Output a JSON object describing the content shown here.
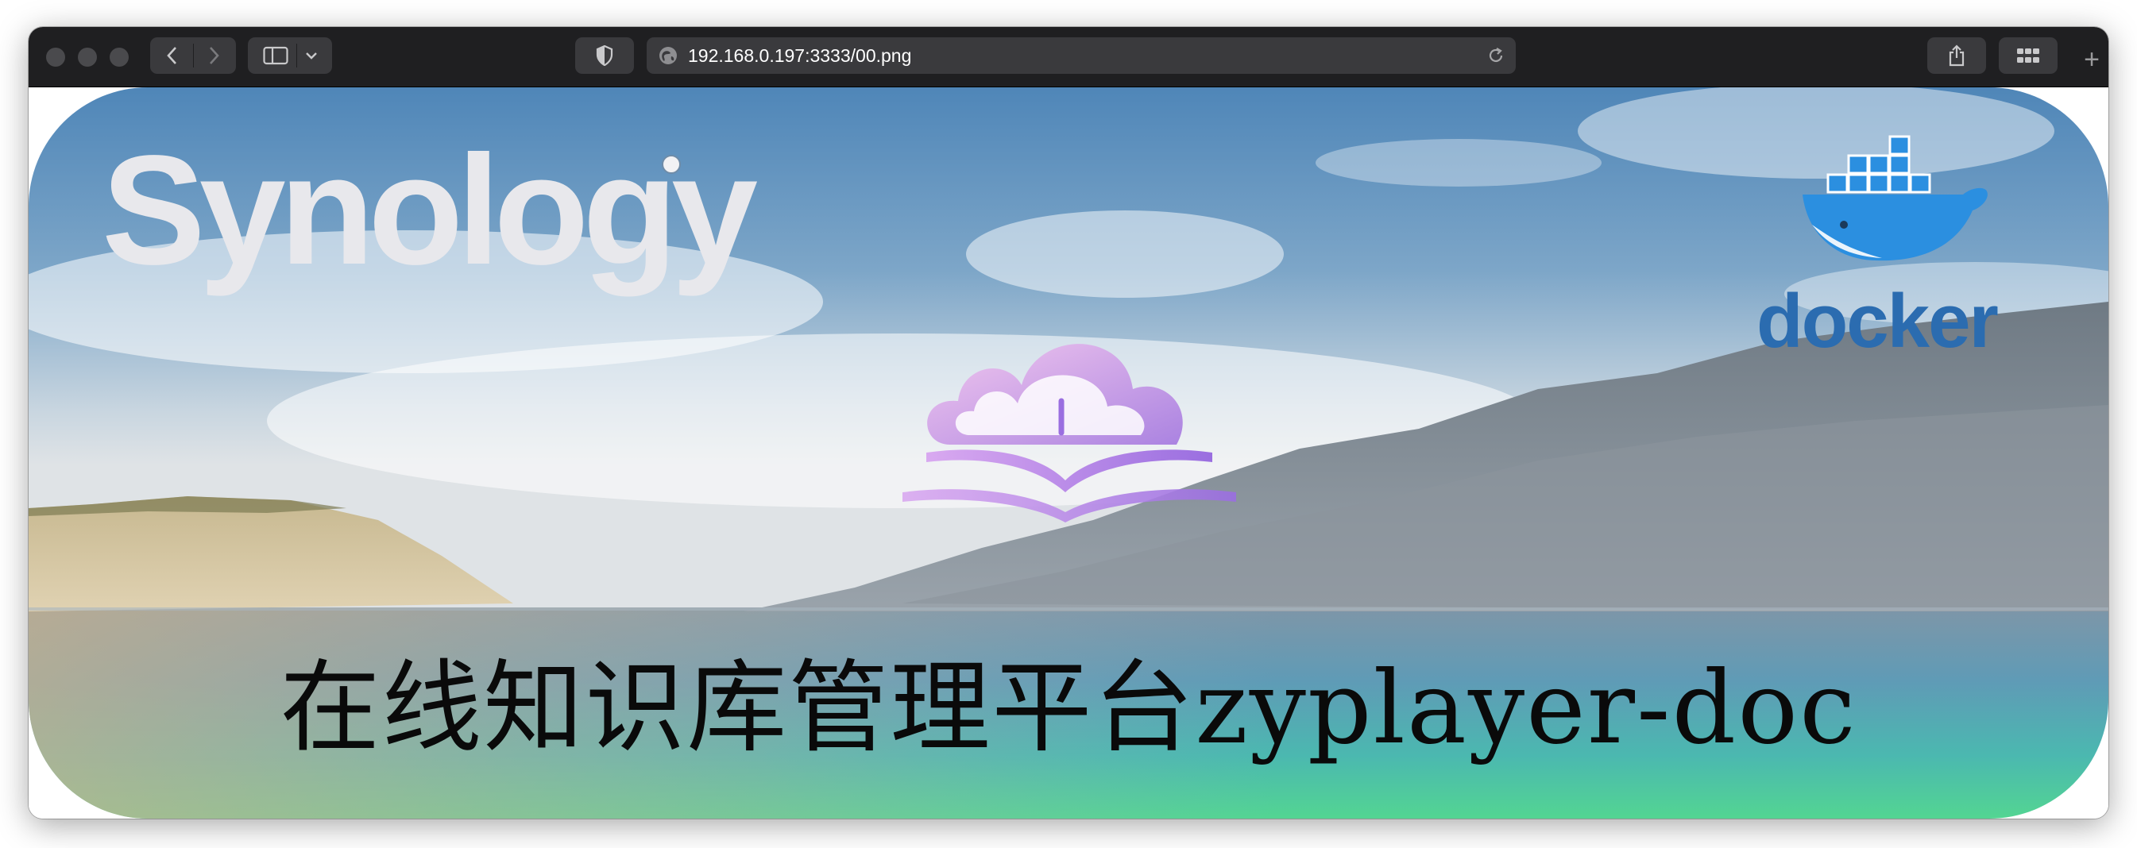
{
  "browser": {
    "url": "192.168.0.197:3333/00.png",
    "new_tab_label": "+"
  },
  "banner": {
    "logo_left_text": "Synology",
    "logo_right_text": "docker",
    "caption": "在线知识库管理平台zyplayer-doc"
  },
  "icons": {
    "back": "chevron-left-icon",
    "forward": "chevron-right-icon",
    "sidebar": "sidebar-icon",
    "sidebar_menu": "chevron-down-icon",
    "privacy": "shield-icon",
    "site": "globe-icon",
    "reload": "reload-icon",
    "share": "share-icon",
    "tabs": "tab-overview-icon"
  },
  "colors": {
    "toolbar": "#1f1f21",
    "control": "#3a3a3d",
    "docker_blue": "#2b6cb0"
  }
}
